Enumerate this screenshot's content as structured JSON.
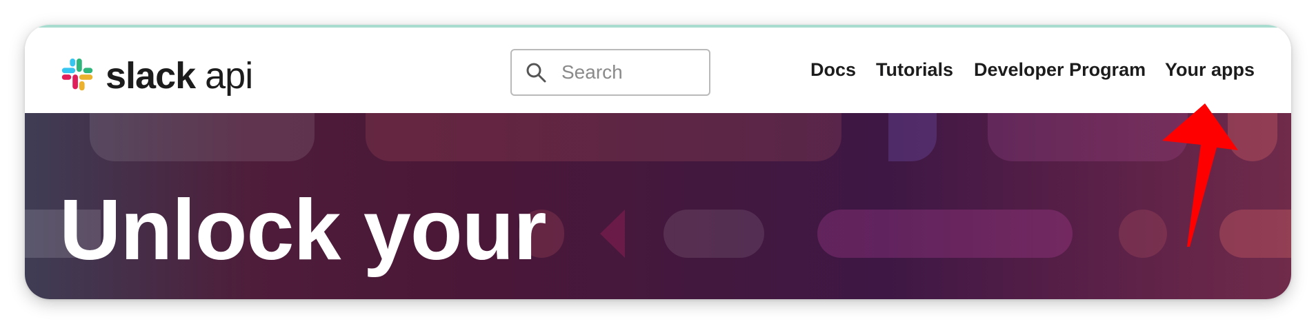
{
  "brand": {
    "word1": "slack",
    "word2": "api",
    "logo_colors": [
      "#36C5F0",
      "#2EB67D",
      "#ECB22E",
      "#E01E5A"
    ]
  },
  "search": {
    "placeholder": "Search",
    "value": "",
    "icon": "search-icon"
  },
  "nav": {
    "items": [
      {
        "label": "Docs"
      },
      {
        "label": "Tutorials"
      },
      {
        "label": "Developer Program"
      },
      {
        "label": "Your apps"
      }
    ]
  },
  "hero": {
    "title": "Unlock your"
  },
  "annotation": {
    "icon": "red-arrow-icon",
    "color": "#FF0000"
  },
  "colors": {
    "header_accent": "#A8DCCF",
    "text": "#1D1C1D",
    "hero_base": "#4B1738"
  }
}
